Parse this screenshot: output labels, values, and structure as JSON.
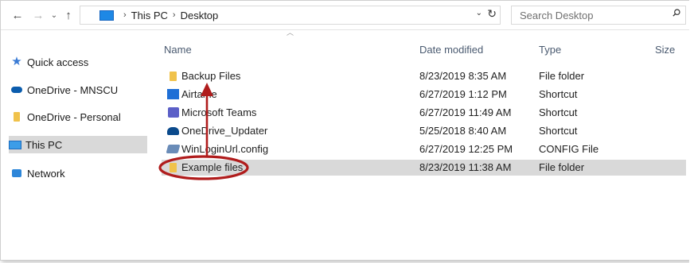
{
  "nav_buttons": {
    "back": "←",
    "forward": "→",
    "recent": "⌄",
    "up": "↑"
  },
  "address": {
    "crumbs": [
      "This PC",
      "Desktop"
    ],
    "separator": "›",
    "dropdown": "⌄",
    "refresh": "↻"
  },
  "search": {
    "placeholder": "Search Desktop"
  },
  "navigation_pane": {
    "items": [
      {
        "label": "Quick access",
        "icon": "star-icon"
      },
      {
        "label": "OneDrive - MNSCU",
        "icon": "onedrive-icon"
      },
      {
        "label": "OneDrive - Personal",
        "icon": "folder-icon"
      },
      {
        "label": "This PC",
        "icon": "this-pc-icon",
        "selected": true
      },
      {
        "label": "Network",
        "icon": "network-icon"
      }
    ]
  },
  "columns": {
    "sort_indicator": "︿",
    "name": "Name",
    "date_modified": "Date modified",
    "type": "Type",
    "size": "Size"
  },
  "files": [
    {
      "name": "Backup Files",
      "date": "8/23/2019 8:35 AM",
      "type": "File folder",
      "icon": "folder-icon"
    },
    {
      "name": "Airtame",
      "date": "6/27/2019 1:12 PM",
      "type": "Shortcut",
      "icon": "airtame-icon"
    },
    {
      "name": "Microsoft Teams",
      "date": "6/27/2019 11:49 AM",
      "type": "Shortcut",
      "icon": "teams-icon"
    },
    {
      "name": "OneDrive_Updater",
      "date": "5/25/2018 8:40 AM",
      "type": "Shortcut",
      "icon": "onedrive-icon"
    },
    {
      "name": "WinLoginUrl.config",
      "date": "6/27/2019 12:25 PM",
      "type": "CONFIG File",
      "icon": "config-file-icon"
    },
    {
      "name": "Example files",
      "date": "8/23/2019 11:38 AM",
      "type": "File folder",
      "icon": "folder-icon",
      "selected": true
    }
  ],
  "colors": {
    "annotation": "#b01c1c",
    "selection": "#d9d9d9",
    "accent": "#1e88e5"
  }
}
